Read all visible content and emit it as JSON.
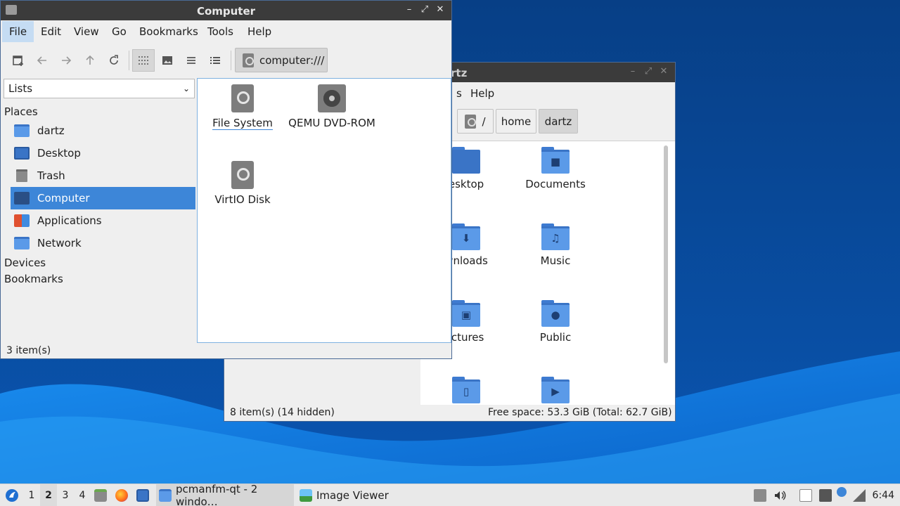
{
  "computer_window": {
    "title": "Computer",
    "menu": [
      "File",
      "Edit",
      "View",
      "Go",
      "Bookmarks",
      "Tools",
      "Help"
    ],
    "path": "computer:///",
    "side_pane_mode": "Lists",
    "sidebar": {
      "places_header": "Places",
      "places": [
        "dartz",
        "Desktop",
        "Trash",
        "Computer",
        "Applications",
        "Network"
      ],
      "selected": "Computer",
      "devices_header": "Devices",
      "bookmarks_header": "Bookmarks"
    },
    "items": [
      "File System",
      "QEMU DVD-ROM",
      "VirtIO Disk"
    ],
    "status": "3 item(s)"
  },
  "dartz_window": {
    "title_fragment": "rtz",
    "menu_visible": [
      "s",
      "Help"
    ],
    "breadcrumbs": [
      "/",
      "home",
      "dartz"
    ],
    "folders": [
      "esktop",
      "Documents",
      "wnloads",
      "Music",
      "ictures",
      "Public"
    ],
    "status_left": "8 item(s) (14 hidden)",
    "status_right": "Free space: 53.3 GiB (Total: 62.7 GiB)"
  },
  "taskbar": {
    "desktops": [
      "1",
      "2",
      "3",
      "4"
    ],
    "current_desktop": "2",
    "tasks": [
      "pcmanfm-qt - 2 windo…",
      "Image Viewer"
    ],
    "clock": "6:44"
  },
  "colors": {
    "selection": "#3d86d8",
    "folder": "#5b9ae8",
    "titlebar": "#3b3b3b"
  }
}
